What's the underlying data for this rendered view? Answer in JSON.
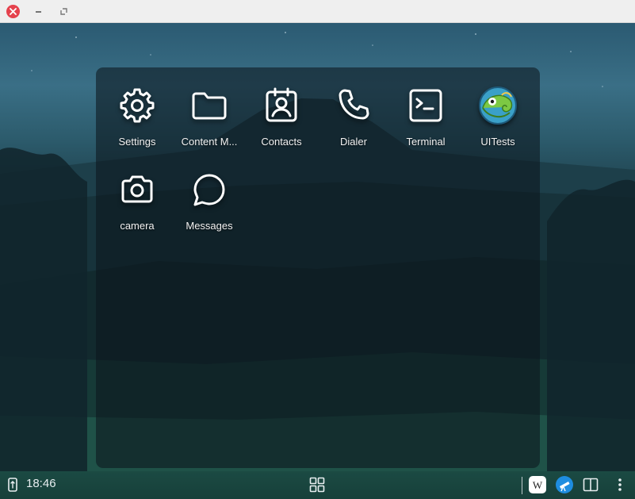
{
  "window": {
    "controls": [
      "close-icon",
      "minimize-icon",
      "restore-icon"
    ]
  },
  "launcher": {
    "apps": [
      {
        "label": "Settings",
        "icon": "gear-icon"
      },
      {
        "label": "Content M...",
        "icon": "folder-icon"
      },
      {
        "label": "Contacts",
        "icon": "contact-card-icon"
      },
      {
        "label": "Dialer",
        "icon": "phone-icon"
      },
      {
        "label": "Terminal",
        "icon": "terminal-icon"
      },
      {
        "label": "UITests",
        "icon": "chameleon-logo-icon"
      },
      {
        "label": "camera",
        "icon": "camera-icon"
      },
      {
        "label": "Messages",
        "icon": "chat-bubble-icon"
      }
    ]
  },
  "taskbar": {
    "time": "18:46",
    "icons": [
      "screen-rotation-icon",
      "app-grid-icon",
      "wikipedia-icon",
      "telescope-icon",
      "split-view-icon",
      "kebab-menu-icon"
    ]
  },
  "colors": {
    "accent_close": "#e5424d",
    "launcher_bg": "#0c161e",
    "text": "#f2f2f2"
  }
}
